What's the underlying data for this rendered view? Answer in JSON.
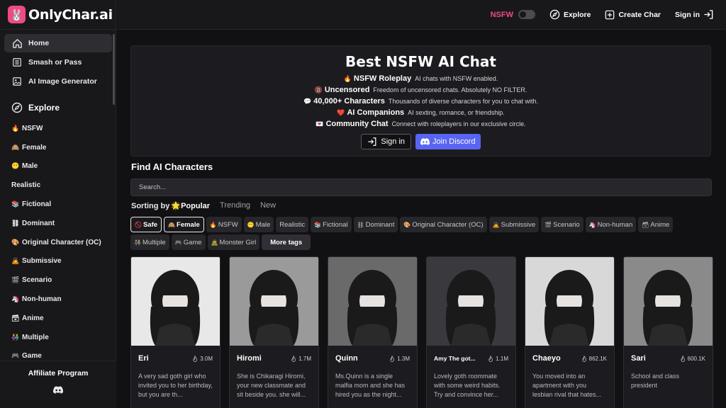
{
  "app": {
    "name": "OnlyChar.ai"
  },
  "sidebar": {
    "nav": [
      {
        "label": "Home",
        "icon": "home-icon",
        "active": true
      },
      {
        "label": "Smash or Pass",
        "icon": "list-icon"
      },
      {
        "label": "AI Image Generator",
        "icon": "image-icon"
      }
    ],
    "explore_label": "Explore",
    "tags": [
      {
        "emoji": "🔥",
        "label": "NSFW"
      },
      {
        "emoji": "🙈",
        "label": "Female"
      },
      {
        "emoji": "😶",
        "label": "Male"
      },
      {
        "emoji": "",
        "label": "Realistic"
      },
      {
        "emoji": "📚",
        "label": "Fictional"
      },
      {
        "emoji": "⛓",
        "label": "Dominant"
      },
      {
        "emoji": "🎨",
        "label": "Original Character (OC)"
      },
      {
        "emoji": "🙇",
        "label": "Submissive"
      },
      {
        "emoji": "🎬",
        "label": "Scenario"
      },
      {
        "emoji": "🦄",
        "label": "Non-human"
      },
      {
        "emoji": "🗃",
        "label": "Anime"
      },
      {
        "emoji": "👫",
        "label": "Multiple"
      },
      {
        "emoji": "🎮",
        "label": "Game"
      }
    ],
    "affiliate": "Affiliate Program"
  },
  "header": {
    "nsfw_label": "NSFW",
    "explore": "Explore",
    "create": "Create Char",
    "signin": "Sign in"
  },
  "hero": {
    "title": "Best NSFW AI Chat",
    "lines": [
      {
        "emoji": "🔥",
        "bold": "NSFW Roleplay",
        "text": "AI chats with NSFW enabled."
      },
      {
        "emoji": "🔞",
        "bold": "Uncensored",
        "text": "Freedom of uncensored chats. Absolutely NO FILTER."
      },
      {
        "emoji": "💬",
        "bold": "40,000+ Characters",
        "text": "Thousands of diverse characters for you to chat with."
      },
      {
        "emoji": "❤️",
        "bold": "AI Companions",
        "text": "AI sexting, romance, or friendship."
      },
      {
        "emoji": "💌",
        "bold": "Community Chat",
        "text": "Connect with roleplayers in our exclusive circle."
      }
    ],
    "signin": "Sign in",
    "discord": "Join Discord"
  },
  "find": {
    "title": "Find AI Characters",
    "search_placeholder": "Search...",
    "sorting_label": "Sorting by",
    "sort_options": [
      {
        "label": "🌟Popular",
        "active": true
      },
      {
        "label": "Trending"
      },
      {
        "label": "New"
      }
    ]
  },
  "filter_tags": [
    {
      "emoji": "🚫",
      "label": "Safe",
      "selected": true
    },
    {
      "emoji": "🙈",
      "label": "Female",
      "selected": true
    },
    {
      "emoji": "🔥",
      "label": "NSFW"
    },
    {
      "emoji": "😶",
      "label": "Male"
    },
    {
      "emoji": "",
      "label": "Realistic"
    },
    {
      "emoji": "📚",
      "label": "Fictional"
    },
    {
      "emoji": "⛓",
      "label": "Dominant"
    },
    {
      "emoji": "🎨",
      "label": "Original Character (OC)"
    },
    {
      "emoji": "🙇",
      "label": "Submissive"
    },
    {
      "emoji": "🎬",
      "label": "Scenario"
    },
    {
      "emoji": "🦄",
      "label": "Non-human"
    },
    {
      "emoji": "🗃",
      "label": "Anime"
    },
    {
      "emoji": "👫",
      "label": "Multiple"
    },
    {
      "emoji": "🎮",
      "label": "Game"
    },
    {
      "emoji": "🧟",
      "label": "Monster Girl"
    }
  ],
  "more_tags": "More tags",
  "cards": [
    {
      "name": "Eri",
      "count": "3.0M",
      "desc": "A very sad goth girl who invited you to her birthday, but you are th...",
      "bg": "#e8e8e8"
    },
    {
      "name": "Hiromi",
      "count": "1.7M",
      "desc": "She is Chikaragi Hiromi, your new classmate and sit beside you. she will...",
      "bg": "#9a9a9a"
    },
    {
      "name": "Quinn",
      "count": "1.3M",
      "desc": "Ms.Quinn is a single malfia mom and she has hired you as the night...",
      "bg": "#6a6a6a"
    },
    {
      "name": "Amy The got...",
      "count": "1.1M",
      "desc": "Lovely goth roommate with some weird habits. Try and convince her...",
      "bg": "#3a3a3e",
      "small": true
    },
    {
      "name": "Chaeyo",
      "count": "862.1K",
      "desc": "You moved into an apartment with you lesbian rival that hates...",
      "bg": "#d8d8d8"
    },
    {
      "name": "Sari",
      "count": "600.1K",
      "desc": "School and class president",
      "bg": "#8a8a8a"
    }
  ]
}
